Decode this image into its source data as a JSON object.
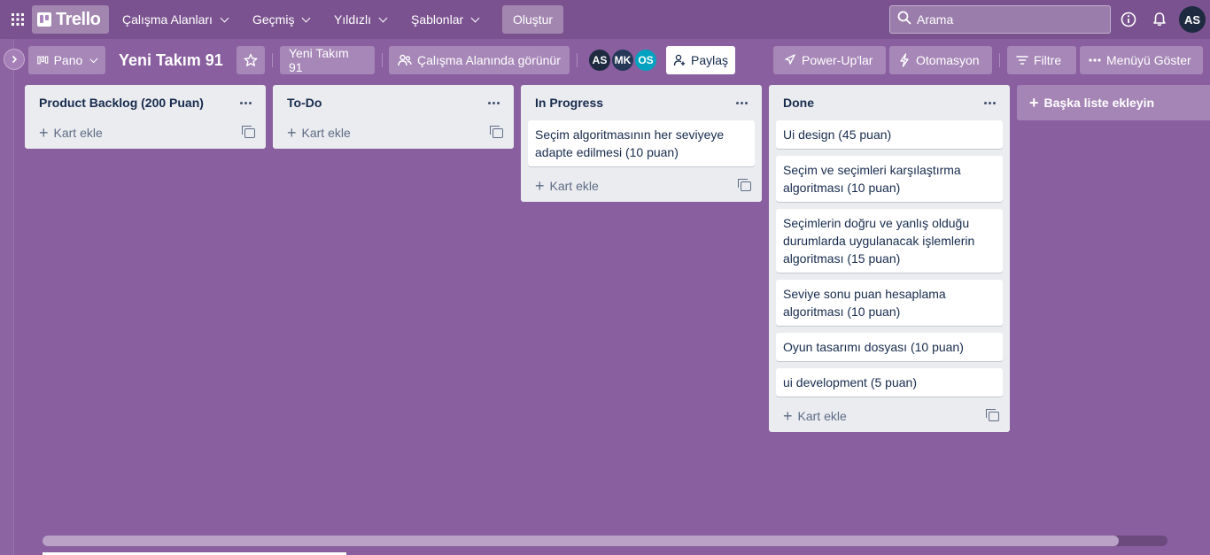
{
  "header": {
    "logo": "Trello",
    "nav": [
      "Çalışma Alanları",
      "Geçmiş",
      "Yıldızlı",
      "Şablonlar"
    ],
    "create": "Oluştur",
    "search_placeholder": "Arama",
    "user_initials": "AS"
  },
  "board": {
    "view": "Pano",
    "title": "Yeni Takım 91",
    "workspace": "Yeni Takım 91",
    "visibility": "Çalışma Alanında görünür",
    "members": [
      {
        "initials": "AS",
        "color": "#1d2a3f"
      },
      {
        "initials": "MK",
        "color": "#253858"
      },
      {
        "initials": "OS",
        "color": "#00a3bf"
      }
    ],
    "share": "Paylaş",
    "powerups": "Power-Up'lar",
    "automation": "Otomasyon",
    "filter": "Filtre",
    "menu": "Menüyü Göster"
  },
  "lists": [
    {
      "title": "Product Backlog (200 Puan)",
      "cards": [],
      "add": "Kart ekle"
    },
    {
      "title": "To-Do",
      "cards": [],
      "add": "Kart ekle"
    },
    {
      "title": "In Progress",
      "cards": [
        "Seçim algoritmasının her seviyeye adapte edilmesi (10 puan)"
      ],
      "add": "Kart ekle"
    },
    {
      "title": "Done",
      "cards": [
        "Ui design (45 puan)",
        "Seçim ve seçimleri karşılaştırma algoritması (10 puan)",
        "Seçimlerin doğru ve yanlış olduğu durumlarda uygulanacak işlemlerin algoritması (15 puan)",
        "Seviye sonu puan hesaplama algoritması (10 puan)",
        "Oyun tasarımı dosyası (10 puan)",
        "ui development (5 puan)"
      ],
      "add": "Kart ekle"
    }
  ],
  "add_list": "Başka liste ekleyin",
  "colors": {
    "background": "#895f9f",
    "header": "#7a528f",
    "list": "#ebecf0"
  }
}
